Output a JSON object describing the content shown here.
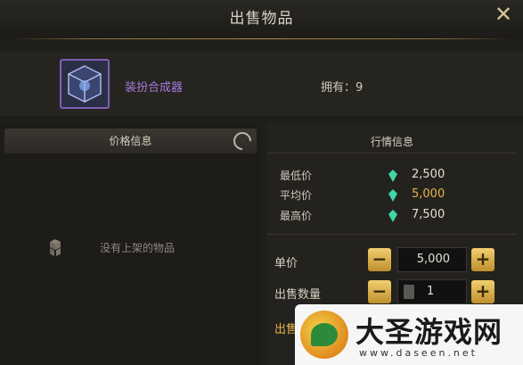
{
  "window": {
    "title": "出售物品",
    "close_glyph": "✕"
  },
  "item": {
    "name": "装扮合成器",
    "own_text": "拥有：9",
    "icon": "cube-icon"
  },
  "price_info": {
    "header": "价格信息",
    "empty_text": "没有上架的物品"
  },
  "market": {
    "header": "行情信息",
    "stats": [
      {
        "label": "最低价",
        "value": "2,500",
        "color": "#e6e0d4"
      },
      {
        "label": "平均价",
        "value": "5,000",
        "color": "#e6b54a"
      },
      {
        "label": "最高价",
        "value": "7,500",
        "color": "#e6e0d4"
      }
    ]
  },
  "sell": {
    "unit_price_label": "单价",
    "unit_price_value": "5,000",
    "quantity_label": "出售数量",
    "quantity_value": "1",
    "minus_glyph": "−",
    "plus_glyph": "+",
    "partial_label": "出售"
  },
  "watermark": {
    "title": "大圣游戏网",
    "url": "www.daseen.net"
  }
}
